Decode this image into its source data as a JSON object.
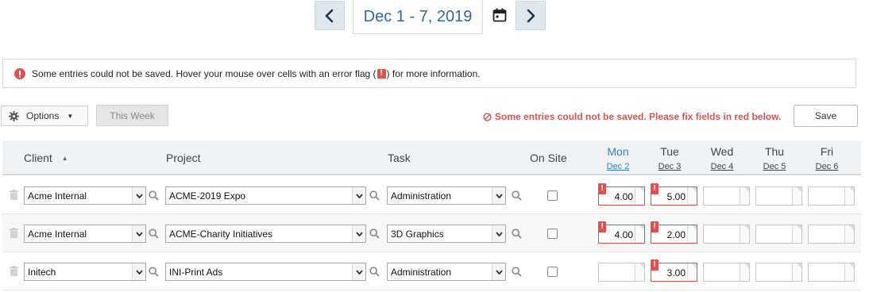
{
  "week_nav": {
    "date_range": "Dec 1 - 7, 2019",
    "prev_icon": "chevron-left-icon",
    "next_icon": "chevron-right-icon",
    "calendar_icon": "calendar-icon"
  },
  "alert": {
    "text_before": "Some entries could not be saved. Hover your mouse over cells with an error flag (",
    "flag_glyph": "!",
    "text_after": ") for more information."
  },
  "toolbar": {
    "options_label": "Options",
    "this_week_label": "This Week",
    "save_error": "Some entries could not be saved. Please fix fields in red below.",
    "save_label": "Save"
  },
  "grid": {
    "columns": {
      "client": "Client",
      "project": "Project",
      "task": "Task",
      "on_site": "On Site"
    },
    "days": [
      {
        "name": "Mon",
        "date": "Dec 2",
        "today": true
      },
      {
        "name": "Tue",
        "date": "Dec 3"
      },
      {
        "name": "Wed",
        "date": "Dec 4"
      },
      {
        "name": "Thu",
        "date": "Dec 5"
      },
      {
        "name": "Fri",
        "date": "Dec 6"
      }
    ],
    "rows": [
      {
        "client": "Acme Internal",
        "project": "ACME-2019 Expo",
        "task": "Administration",
        "on_site": false,
        "hours": [
          {
            "value": "4.00",
            "error": true
          },
          {
            "value": "5.00",
            "error": true
          },
          {
            "value": "",
            "error": false
          },
          {
            "value": "",
            "error": false
          },
          {
            "value": "",
            "error": false
          }
        ]
      },
      {
        "client": "Acme Internal",
        "project": "ACME-Charity Initiatives",
        "task": "3D Graphics",
        "on_site": false,
        "hours": [
          {
            "value": "4.00",
            "error": true
          },
          {
            "value": "2.00",
            "error": true
          },
          {
            "value": "",
            "error": false
          },
          {
            "value": "",
            "error": false
          },
          {
            "value": "",
            "error": false
          }
        ]
      },
      {
        "client": "Initech",
        "project": "INI-Print Ads",
        "task": "Administration",
        "on_site": false,
        "hours": [
          {
            "value": "",
            "error": false
          },
          {
            "value": "3.00",
            "error": true
          },
          {
            "value": "",
            "error": false
          },
          {
            "value": "",
            "error": false
          },
          {
            "value": "",
            "error": false
          }
        ]
      }
    ]
  },
  "colors": {
    "accent": "#2f6a99",
    "error": "#d9534f"
  }
}
